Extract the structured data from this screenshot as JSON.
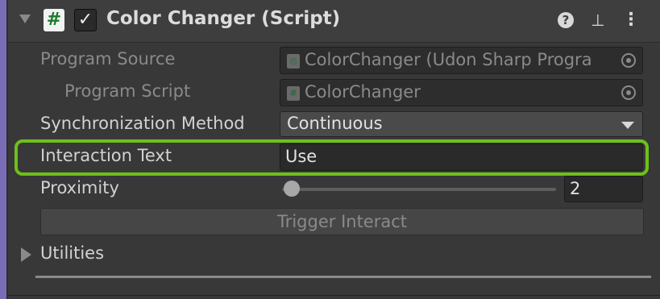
{
  "header": {
    "title": "Color Changer (Script)",
    "script_icon_glyph": "#",
    "enabled_glyph": "✓",
    "help_glyph": "?",
    "presets_glyph": "⊥",
    "more_glyph": "⋮"
  },
  "fields": {
    "program_source": {
      "label": "Program Source",
      "value": "ColorChanger (Udon Sharp Progra",
      "icon": "udon-asset-icon"
    },
    "program_script": {
      "label": "Program Script",
      "value": "ColorChanger",
      "icon": "csharp-script-icon"
    },
    "sync_method": {
      "label": "Synchronization Method",
      "value": "Continuous"
    },
    "interaction_text": {
      "label": "Interaction Text",
      "value": "Use"
    },
    "proximity": {
      "label": "Proximity",
      "value": "2",
      "slider_min": 0,
      "slider_max": 100,
      "slider_value": 2
    }
  },
  "trigger_button": "Trigger Interact",
  "utilities": {
    "label": "Utilities"
  },
  "colors": {
    "highlight": "#6ec01a",
    "accent_bar": "#7a6db8",
    "background": "#383838"
  }
}
